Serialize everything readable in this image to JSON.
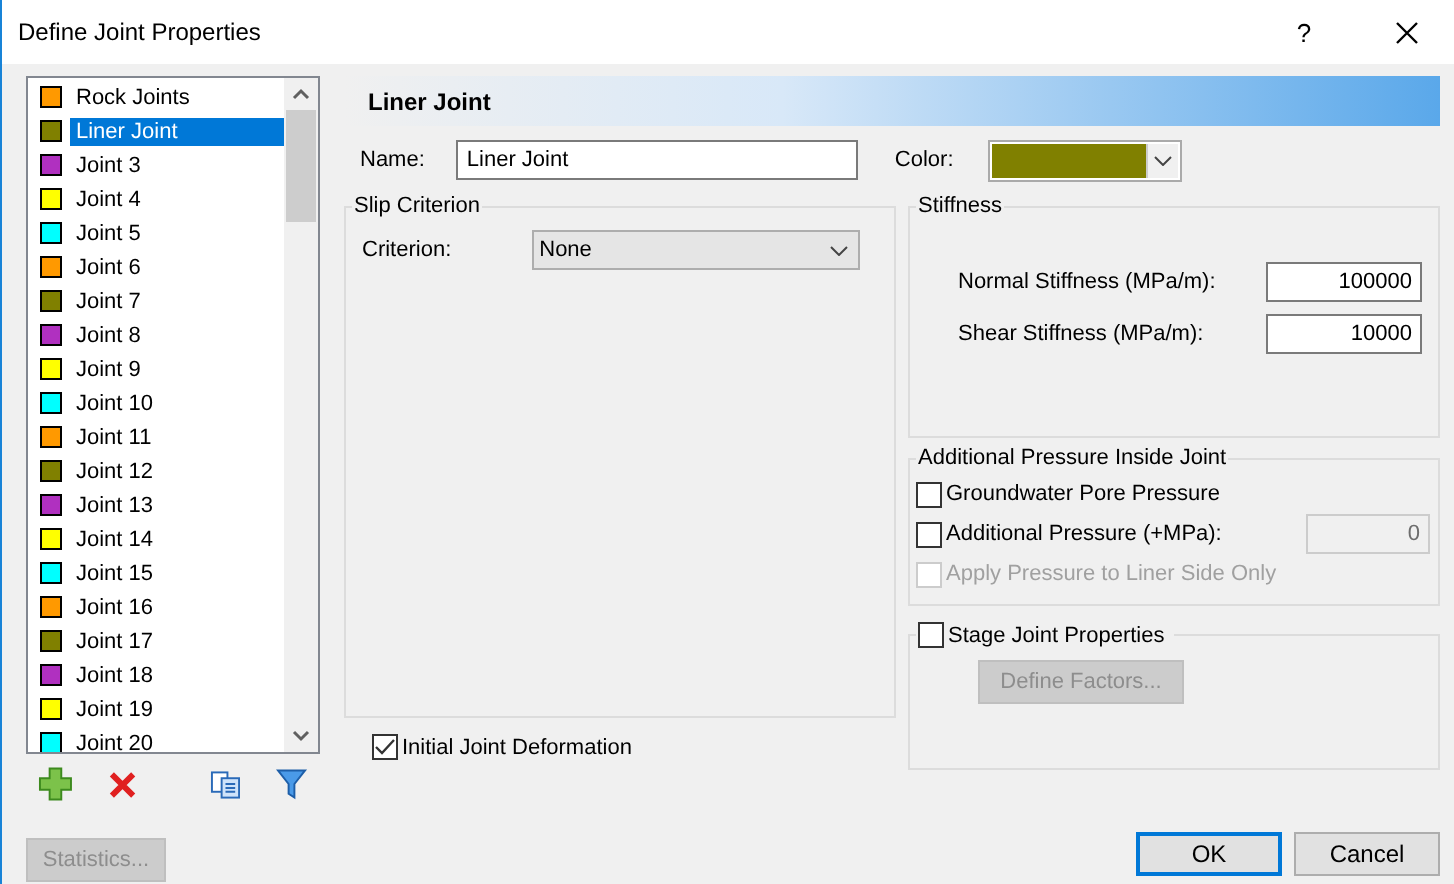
{
  "window": {
    "title": "Define Joint Properties",
    "help": "?"
  },
  "joint_list": [
    {
      "name": "Rock Joints",
      "color": "#ff9900",
      "selected": false
    },
    {
      "name": "Liner Joint",
      "color": "#808000",
      "selected": true
    },
    {
      "name": "Joint 3",
      "color": "#b030c0",
      "selected": false
    },
    {
      "name": "Joint 4",
      "color": "#ffff00",
      "selected": false
    },
    {
      "name": "Joint 5",
      "color": "#00ffff",
      "selected": false
    },
    {
      "name": "Joint 6",
      "color": "#ff9900",
      "selected": false
    },
    {
      "name": "Joint 7",
      "color": "#808000",
      "selected": false
    },
    {
      "name": "Joint 8",
      "color": "#b030c0",
      "selected": false
    },
    {
      "name": "Joint 9",
      "color": "#ffff00",
      "selected": false
    },
    {
      "name": "Joint 10",
      "color": "#00ffff",
      "selected": false
    },
    {
      "name": "Joint 11",
      "color": "#ff9900",
      "selected": false
    },
    {
      "name": "Joint 12",
      "color": "#808000",
      "selected": false
    },
    {
      "name": "Joint 13",
      "color": "#b030c0",
      "selected": false
    },
    {
      "name": "Joint 14",
      "color": "#ffff00",
      "selected": false
    },
    {
      "name": "Joint 15",
      "color": "#00ffff",
      "selected": false
    },
    {
      "name": "Joint 16",
      "color": "#ff9900",
      "selected": false
    },
    {
      "name": "Joint 17",
      "color": "#808000",
      "selected": false
    },
    {
      "name": "Joint 18",
      "color": "#b030c0",
      "selected": false
    },
    {
      "name": "Joint 19",
      "color": "#ffff00",
      "selected": false
    },
    {
      "name": "Joint 20",
      "color": "#00ffff",
      "selected": false
    }
  ],
  "statistics_button": {
    "label": "Statistics...",
    "disabled": true
  },
  "header": "Liner Joint",
  "name_field": {
    "label": "Name:",
    "value": "Liner Joint"
  },
  "color_field": {
    "label": "Color:",
    "color": "#808000"
  },
  "slip_criterion": {
    "title": "Slip Criterion",
    "criterion_label": "Criterion:",
    "value": "None"
  },
  "initial_joint_deformation": {
    "label": "Initial Joint Deformation",
    "checked": true
  },
  "stiffness": {
    "title": "Stiffness",
    "fields": [
      {
        "label": "Normal Stiffness (MPa/m):",
        "value": "100000"
      },
      {
        "label": "Shear Stiffness (MPa/m):",
        "value": "10000"
      }
    ]
  },
  "additional_pressure": {
    "title": "Additional Pressure Inside Joint",
    "options": [
      {
        "label": "Groundwater Pore Pressure",
        "checked": false,
        "disabled": false
      },
      {
        "label": "Additional Pressure (+MPa):",
        "checked": false,
        "disabled": false,
        "value": "0",
        "value_disabled": true
      },
      {
        "label": "Apply Pressure to Liner Side Only",
        "checked": false,
        "disabled": true
      }
    ]
  },
  "stage": {
    "label": "Stage Joint Properties",
    "checked": false,
    "button": {
      "label": "Define Factors...",
      "disabled": true
    }
  },
  "buttons": [
    {
      "label": "OK",
      "default": true
    },
    {
      "label": "Cancel",
      "default": false
    }
  ]
}
